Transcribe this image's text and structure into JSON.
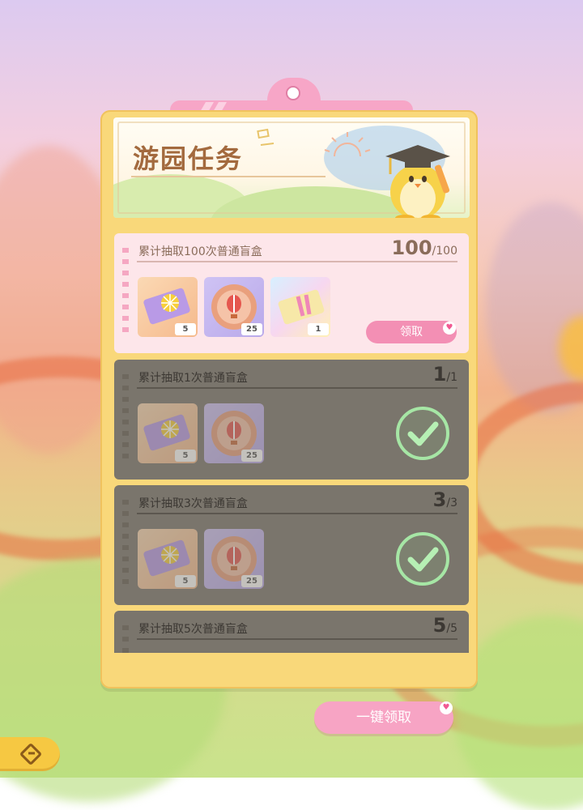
{
  "header": {
    "title": "游园任务"
  },
  "tasks": [
    {
      "name": "累计抽取100次普通盲盒",
      "progress": "100",
      "total": "/100",
      "state": "claimable",
      "rewards": [
        {
          "icon": "ticket-icon",
          "count": "5"
        },
        {
          "icon": "balloon-medal-icon",
          "count": "25"
        },
        {
          "icon": "pass-ticket-icon",
          "count": "1"
        }
      ],
      "claim_label": "领取"
    },
    {
      "name": "累计抽取1次普通盲盒",
      "progress": "1",
      "total": "/1",
      "state": "completed",
      "rewards": [
        {
          "icon": "ticket-icon",
          "count": "5"
        },
        {
          "icon": "balloon-medal-icon",
          "count": "25"
        }
      ]
    },
    {
      "name": "累计抽取3次普通盲盒",
      "progress": "3",
      "total": "/3",
      "state": "completed",
      "rewards": [
        {
          "icon": "ticket-icon",
          "count": "5"
        },
        {
          "icon": "balloon-medal-icon",
          "count": "25"
        }
      ]
    },
    {
      "name": "累计抽取5次普通盲盒",
      "progress": "5",
      "total": "/5",
      "state": "completed",
      "rewards": []
    }
  ],
  "footer": {
    "one_key_claim": "一键领取"
  },
  "colors": {
    "panel": "#f9d87a",
    "pink": "#f38fb4",
    "done": "#7a756c",
    "check": "#a6e6a5"
  }
}
